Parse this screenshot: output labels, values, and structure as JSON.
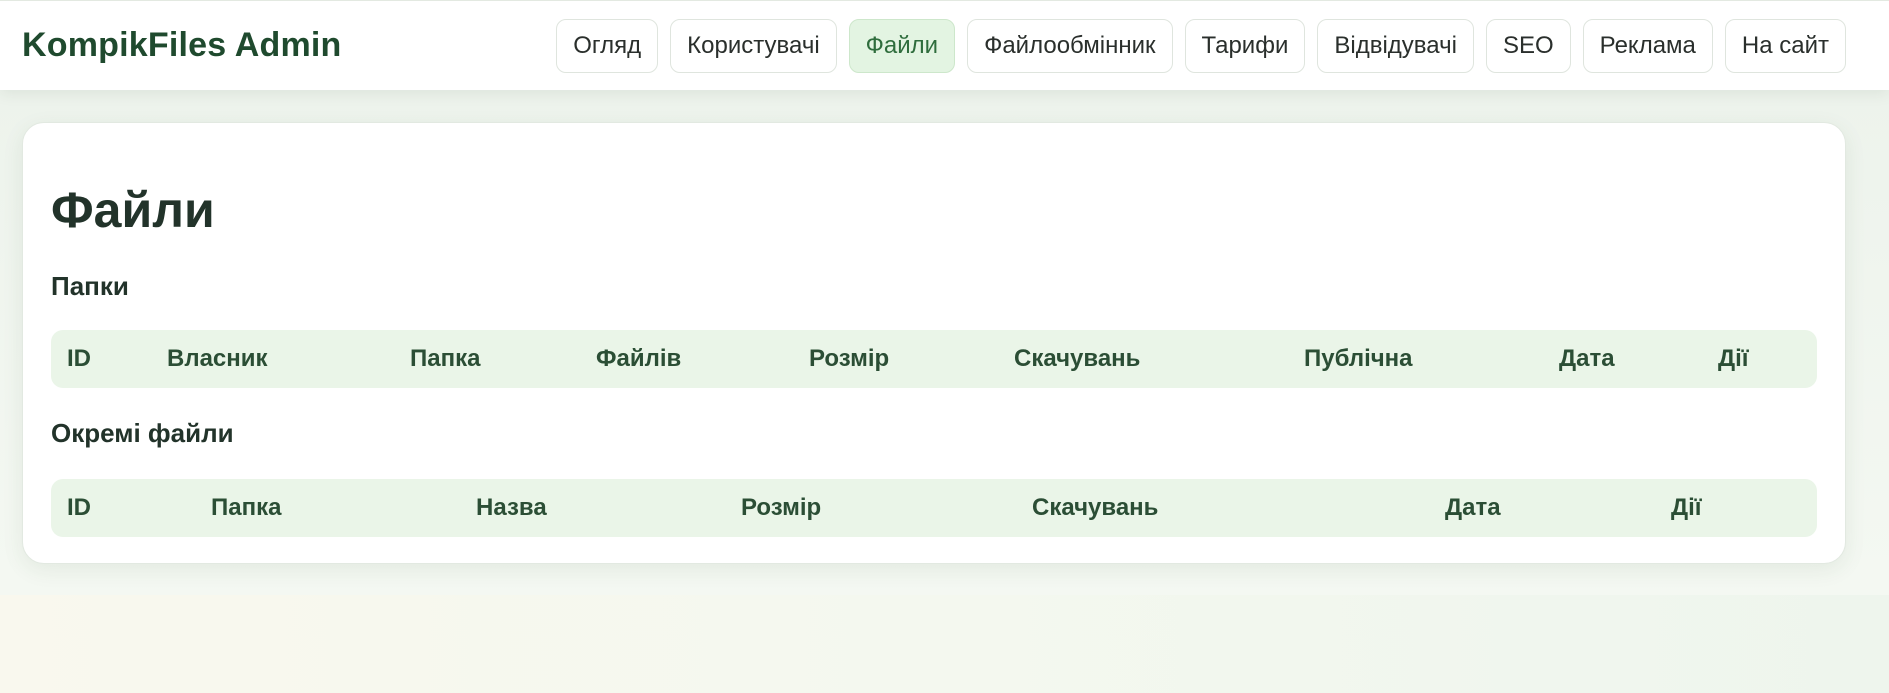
{
  "header": {
    "brand": "KompikFiles Admin",
    "nav": [
      {
        "label": "Огляд",
        "active": false
      },
      {
        "label": "Користувачі",
        "active": false
      },
      {
        "label": "Файли",
        "active": true
      },
      {
        "label": "Файлообмінник",
        "active": false
      },
      {
        "label": "Тарифи",
        "active": false
      },
      {
        "label": "Відвідувачі",
        "active": false
      },
      {
        "label": "SEO",
        "active": false
      },
      {
        "label": "Реклама",
        "active": false
      },
      {
        "label": "На сайт",
        "active": false
      }
    ]
  },
  "main": {
    "title": "Файли",
    "folders": {
      "title": "Папки",
      "columns": [
        "ID",
        "Власник",
        "Папка",
        "Файлів",
        "Розмір",
        "Скачувань",
        "Публічна",
        "Дата",
        "Дії"
      ]
    },
    "files": {
      "title": "Окремі файли",
      "columns": [
        "ID",
        "Папка",
        "Назва",
        "Розмір",
        "Скачувань",
        "Дата",
        "Дії"
      ]
    }
  },
  "colors": {
    "brand": "#1f4a2e",
    "active_nav_bg": "#e3f4e2",
    "active_nav_text": "#2f6d3d",
    "table_header_bg": "#eaf5e8"
  }
}
